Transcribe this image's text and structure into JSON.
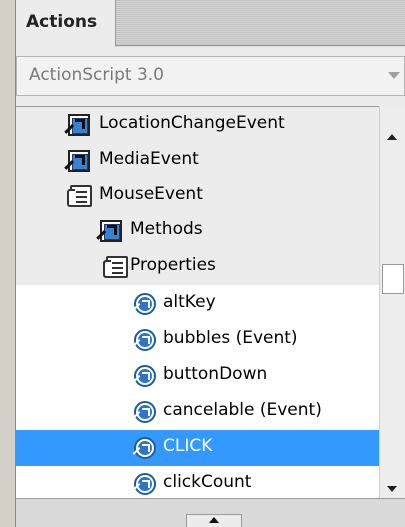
{
  "panel": {
    "tab_label": "Actions",
    "language_select": {
      "value": "ActionScript 3.0"
    }
  },
  "tree": {
    "rows": [
      {
        "label": "LocationChangeEvent",
        "icon": "class-book-icon"
      },
      {
        "label": "MediaEvent",
        "icon": "class-book-icon"
      },
      {
        "label": "MouseEvent",
        "icon": "open-page-icon"
      },
      {
        "label": "Methods",
        "icon": "class-book-icon"
      },
      {
        "label": "Properties",
        "icon": "open-page-icon"
      },
      {
        "label": "altKey",
        "icon": "property-icon"
      },
      {
        "label": "bubbles (Event)",
        "icon": "property-icon"
      },
      {
        "label": "buttonDown",
        "icon": "property-icon"
      },
      {
        "label": "cancelable (Event)",
        "icon": "property-icon"
      },
      {
        "label": "CLICK",
        "icon": "property-icon",
        "selected": true
      },
      {
        "label": "clickCount",
        "icon": "property-icon"
      }
    ]
  },
  "colors": {
    "selection": "#3399ff",
    "icon_blue": "#2e74c9"
  }
}
